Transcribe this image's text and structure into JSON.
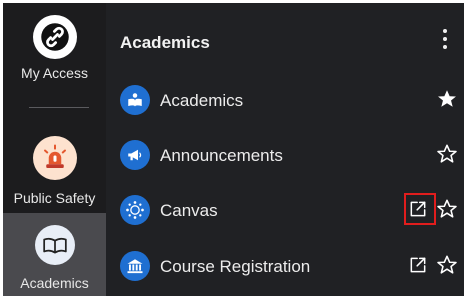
{
  "sidebar": {
    "items": [
      {
        "label": "My Access",
        "icon": "link-icon"
      },
      {
        "label": "Public Safety",
        "icon": "siren-icon"
      },
      {
        "label": "Academics",
        "icon": "open-book-icon",
        "active": true
      }
    ]
  },
  "header": {
    "title": "Academics",
    "menu_icon": "kebab-menu-icon"
  },
  "list": [
    {
      "label": "Academics",
      "icon": "academics-icon",
      "favorite": true,
      "external_link": false
    },
    {
      "label": "Announcements",
      "icon": "megaphone-icon",
      "favorite": false,
      "external_link": false
    },
    {
      "label": "Canvas",
      "icon": "canvas-icon",
      "favorite": false,
      "external_link": true,
      "highlighted": true
    },
    {
      "label": "Course Registration",
      "icon": "university-icon",
      "favorite": false,
      "external_link": true
    }
  ],
  "colors": {
    "accent": "#1f6fd1",
    "highlight": "#e11d1d",
    "background": "#202124"
  }
}
